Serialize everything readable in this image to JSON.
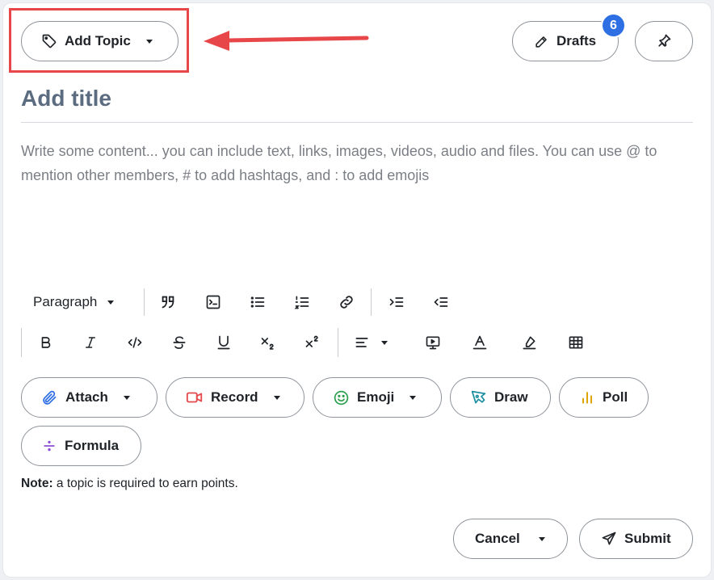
{
  "header": {
    "add_topic_label": "Add Topic",
    "drafts_label": "Drafts",
    "drafts_count": "6"
  },
  "editor": {
    "title_placeholder": "Add title",
    "content_placeholder": "Write some content... you can include text, links, images, videos, audio and files. You can use @ to mention other members, # to add hashtags, and : to add emojis"
  },
  "toolbar": {
    "paragraph_label": "Paragraph",
    "row1_icons": [
      "blockquote-icon",
      "code-block-icon",
      "bullet-list-icon",
      "numbered-list-icon",
      "link-icon",
      "indent-icon",
      "outdent-icon"
    ],
    "row2_icons": [
      "bold-icon",
      "italic-icon",
      "inline-code-icon",
      "strikethrough-icon",
      "underline-icon",
      "subscript-icon",
      "superscript-icon",
      "align-icon",
      "embed-icon",
      "text-color-icon",
      "highlight-icon",
      "table-icon"
    ]
  },
  "attachments": {
    "attach_label": "Attach",
    "record_label": "Record",
    "emoji_label": "Emoji",
    "draw_label": "Draw",
    "poll_label": "Poll",
    "formula_label": "Formula"
  },
  "note": {
    "prefix": "Note:",
    "text": " a topic is required to earn points."
  },
  "footer": {
    "cancel_label": "Cancel",
    "submit_label": "Submit"
  },
  "colors": {
    "highlight": "#e8474a",
    "badge": "#2f6fe4",
    "title": "#5b6b80",
    "attach_icon": "#2f6fe4",
    "record_icon": "#e5484d",
    "emoji_icon": "#2e9e4f",
    "draw_icon": "#1b8fa0",
    "poll_icon": "#e0a400",
    "formula_icon": "#8b4fd6"
  }
}
